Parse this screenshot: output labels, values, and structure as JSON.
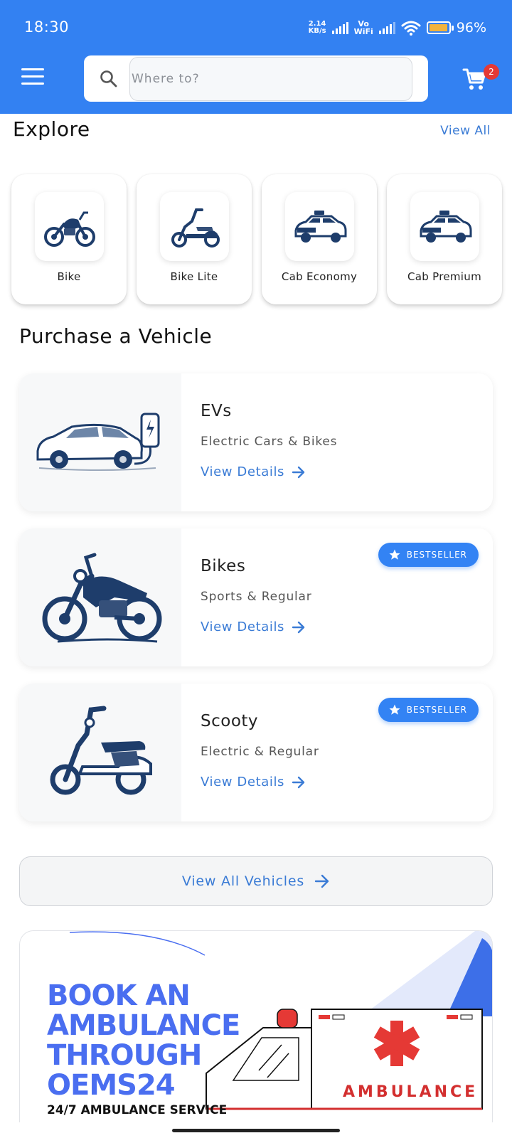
{
  "status_bar": {
    "time": "18:30",
    "net_speed_value": "2.14",
    "net_speed_unit": "KB/s",
    "volte_top": "Vo",
    "volte_bottom": "WiFi",
    "battery_percent": "96%",
    "battery_level": 0.96
  },
  "header": {
    "menu_icon": "hamburger-menu-icon",
    "search": {
      "placeholder": "Where to?",
      "icon": "search-icon"
    },
    "cart": {
      "icon": "cart-icon",
      "badge_count": "2"
    },
    "colors": {
      "bar": "#3381f2",
      "badge": "#e53935"
    }
  },
  "explore": {
    "title": "Explore",
    "view_all_label": "View All",
    "items": [
      {
        "label": "Bike",
        "icon": "motorbike-icon"
      },
      {
        "label": "Bike Lite",
        "icon": "scooter-icon"
      },
      {
        "label": "Cab Economy",
        "icon": "taxi-icon"
      },
      {
        "label": "Cab Premium",
        "icon": "taxi-icon"
      }
    ]
  },
  "purchase": {
    "title": "Purchase a Vehicle",
    "cards": [
      {
        "name": "EVs",
        "subtitle": "Electric Cars & Bikes",
        "link_label": "View Details",
        "badge": "",
        "image": "ev-charging-car-icon"
      },
      {
        "name": "Bikes",
        "subtitle": "Sports & Regular",
        "link_label": "View Details",
        "badge": "BESTSELLER",
        "image": "motorbike-icon"
      },
      {
        "name": "Scooty",
        "subtitle": "Electric & Regular",
        "link_label": "View Details",
        "badge": "BESTSELLER",
        "image": "scooter-icon"
      }
    ],
    "view_all_label": "View All Vehicles",
    "accent": "#3a7bd5"
  },
  "banner": {
    "headline": [
      "BOOK AN",
      "AMBULANCE",
      "THROUGH",
      "OEMS24"
    ],
    "subheadline": "24/7 AMBULANCE SERVICE",
    "vehicle_text": "AMBULANCE",
    "colors": {
      "headline": "#4a6ef0",
      "red": "#d32f2f"
    }
  }
}
